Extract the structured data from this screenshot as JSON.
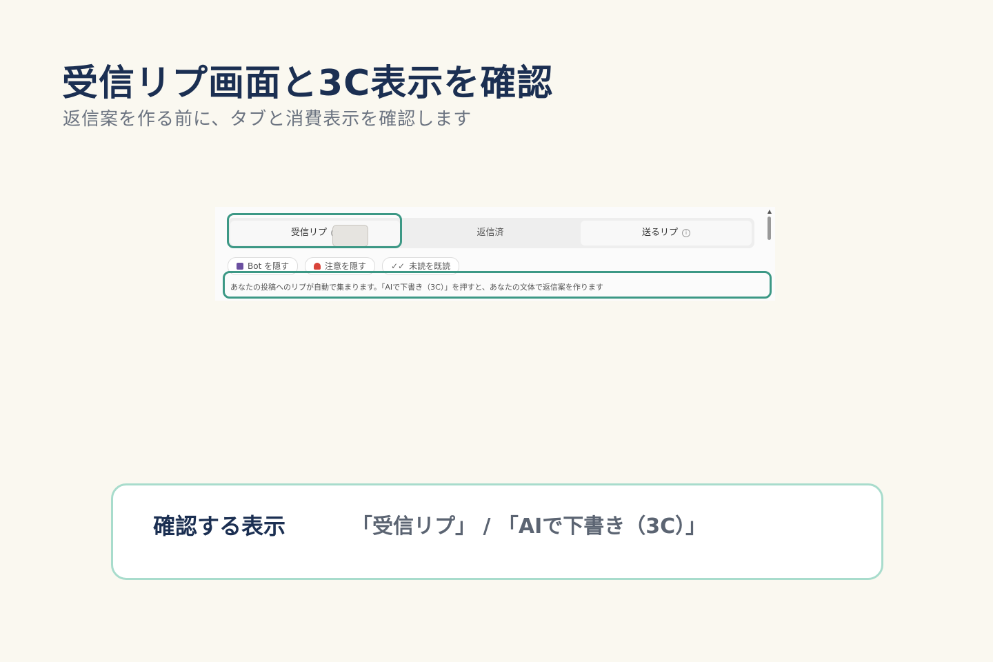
{
  "page": {
    "title": "受信リプ画面と3C表示を確認",
    "subtitle": "返信案を作る前に、タブと消費表示を確認します"
  },
  "screenshot": {
    "tabs": [
      {
        "label": "受信リプ",
        "info": "i",
        "active": true
      },
      {
        "label": "返信済",
        "active": false
      },
      {
        "label": "送るリプ",
        "info": "i",
        "active": true
      }
    ],
    "filters": [
      {
        "label": "Bot を隠す",
        "icon": "robot-icon",
        "color": "#6b4fa0"
      },
      {
        "label": "注意を隠す",
        "icon": "warning-icon",
        "color": "#d9443a"
      },
      {
        "label": "未読を既読",
        "icon": "double-check-icon",
        "color": "#666666"
      }
    ],
    "hint": "あなたの投稿へのリプが自動で集まります。「AIで下書き（3C）」を押すと、あなたの文体で返信案を作ります",
    "scroll_up": "▲"
  },
  "card": {
    "label": "確認する表示",
    "value": "「受信リプ」 / 「AIで下書き（3C）」"
  },
  "colors": {
    "highlight": "#3c9885",
    "card_border": "#a8dccc",
    "title": "#1b2f52",
    "background": "#faf8f0"
  }
}
